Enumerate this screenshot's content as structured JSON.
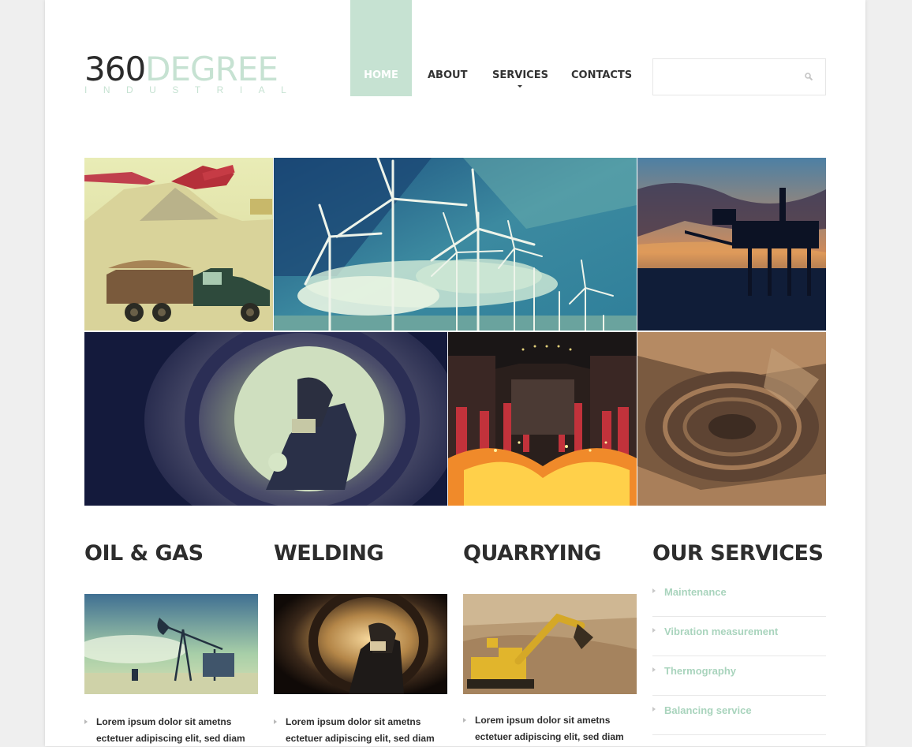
{
  "logo": {
    "number": "360",
    "word": "DEGREE",
    "tagline": "INDUSTRIAL"
  },
  "nav": {
    "items": [
      {
        "label": "HOME",
        "active": true
      },
      {
        "label": "ABOUT",
        "active": false
      },
      {
        "label": "SERVICES",
        "active": false,
        "has_submenu": true
      },
      {
        "label": "CONTACTS",
        "active": false
      }
    ]
  },
  "search": {
    "placeholder": "",
    "icon": "search-icon"
  },
  "gallery": {
    "tiles": [
      "quarry-trucks-photo",
      "wind-turbines-photo",
      "oil-platform-sunset-photo",
      "pipe-welder-photo",
      "steel-furnace-photo",
      "open-pit-mine-photo"
    ]
  },
  "columns": [
    {
      "title": "OIL & GAS",
      "image": "pumpjack-photo",
      "text": "Lorem ipsum dolor sit ametns ectetuer adipiscing elit, sed diam"
    },
    {
      "title": "WELDING",
      "image": "welder-photo",
      "text": "Lorem ipsum dolor sit ametns ectetuer adipiscing elit, sed diam"
    },
    {
      "title": "QUARRYING",
      "image": "excavator-photo",
      "text": "Lorem ipsum dolor sit ametns ectetuer adipiscing elit, sed diam"
    }
  ],
  "services": {
    "title": "OUR SERVICES",
    "items": [
      "Maintenance",
      "Vibration measurement",
      "Thermography",
      "Balancing service"
    ]
  },
  "colors": {
    "accent": "#c6e2d2",
    "service_link": "#a9d4bd",
    "heading": "#2d2d2d",
    "page_bg": "#efefef"
  }
}
